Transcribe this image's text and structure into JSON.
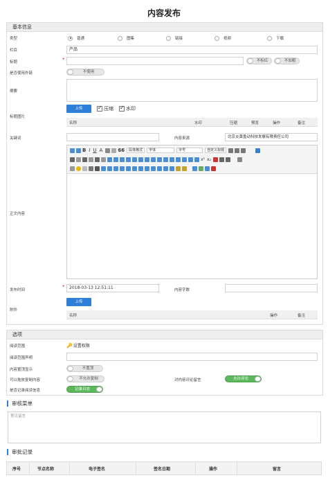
{
  "page_title": "内容发布",
  "basic": {
    "header": "基本信息",
    "type_label": "类型",
    "type_options": [
      "普通",
      "图集",
      "链接",
      "视频",
      "下载"
    ],
    "column_label": "栏目",
    "column_value": "产品",
    "title_label": "标题",
    "title_value": "",
    "bold_toggle": "不标红",
    "add_toggle": "不加粗",
    "extlink_label": "是否使用外链",
    "extlink_toggle": "不使用",
    "summary_label": "摘要",
    "thumb_label": "标题图片",
    "upload_label": "上传",
    "compress_label": "压缩",
    "watermark_label": "水印",
    "thumb_cols": [
      "名称",
      "水印",
      "压缩",
      "预览",
      "操作",
      "备注"
    ],
    "keywords_label": "关键词",
    "source_label": "内容来源",
    "source_value": "北京炎黄盈动科技发展有限责任公司",
    "body_label": "正文内容",
    "toolbar": {
      "para_format": "段落格式",
      "font": "字体",
      "size": "字号",
      "custom_title": "自定义标题"
    },
    "publish_time_label": "发布时间",
    "publish_time_value": "2018-03-13 12:51:11",
    "word_count_label": "内容字数",
    "attach_label": "附件",
    "attach_upload": "上传",
    "attach_cols": [
      "名称",
      "操作",
      "备注"
    ]
  },
  "options": {
    "header": "选项",
    "scope_label": "阅读范围",
    "scope_link": "设置权限",
    "scope_decl_label": "阅读范围声明",
    "top_label": "内容置顶显示",
    "top_toggle": "不置顶",
    "copy_label": "可以拖放复制内容",
    "copy_toggle": "不允许复制",
    "comment_label": "对内容评论留言",
    "comment_toggle": "允许评论",
    "log_label": "是否记录阅读信息",
    "log_toggle": "记录日志"
  },
  "audit_menu": {
    "title": "审核菜单",
    "placeholder": "意见留言"
  },
  "approval_log": {
    "title": "审批记录",
    "cols": [
      "序号",
      "节点名称",
      "电子签名",
      "签名日期",
      "操作",
      "留言"
    ]
  },
  "colors": {
    "accent": "#2d7fd8",
    "toggle_on": "#5cb85c",
    "required": "#e02020"
  }
}
